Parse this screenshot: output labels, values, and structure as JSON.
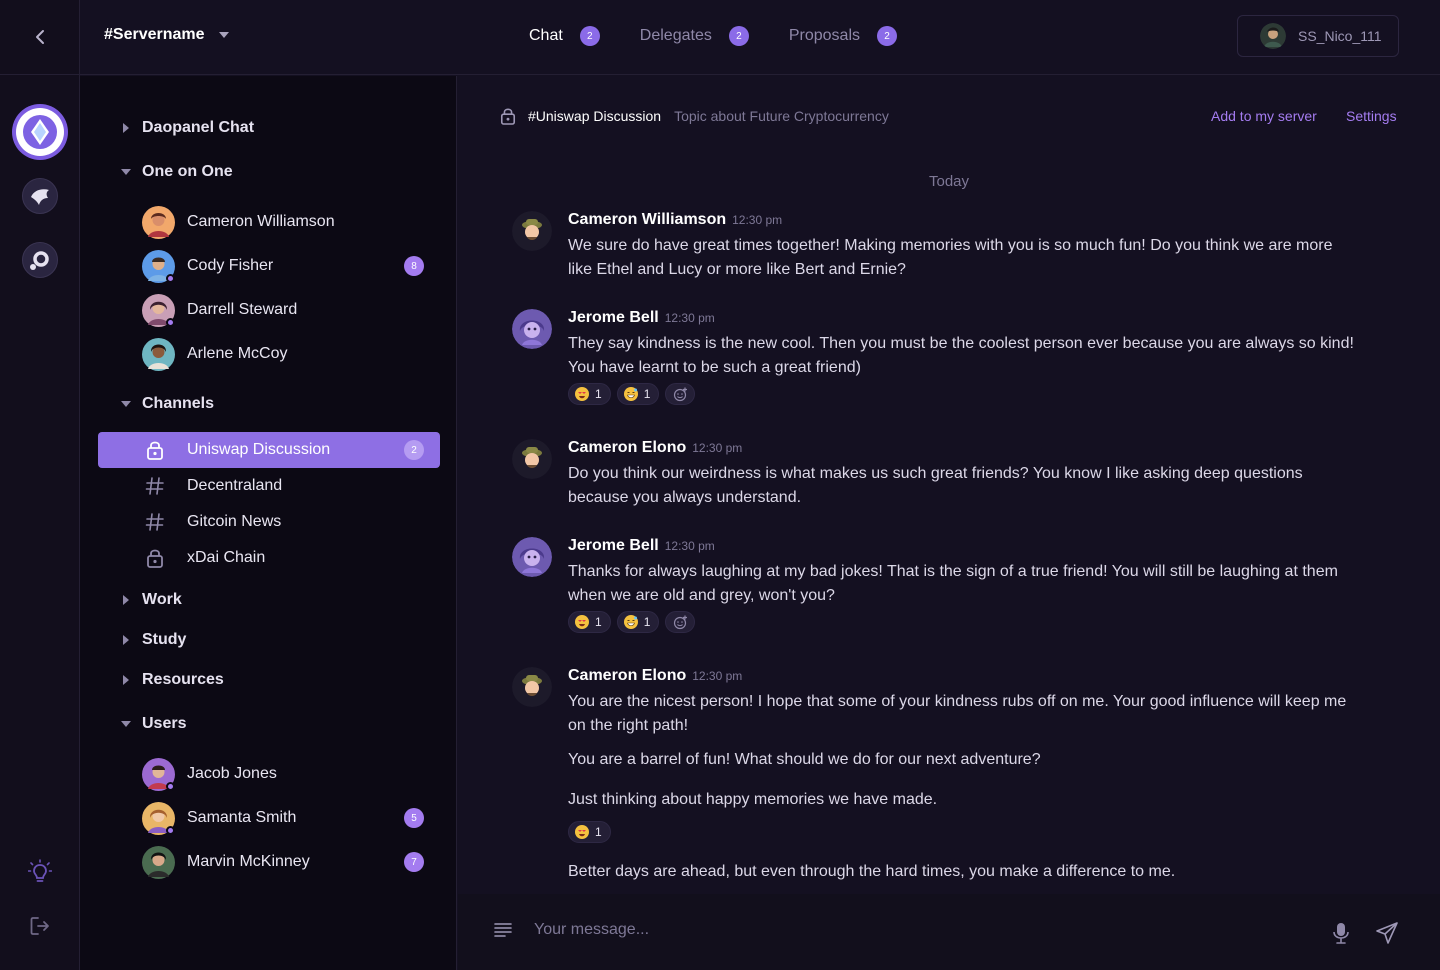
{
  "topbar": {
    "server_name": "#Servername",
    "tabs": [
      {
        "label": "Chat",
        "count": "2"
      },
      {
        "label": "Delegates",
        "count": "2"
      },
      {
        "label": "Proposals",
        "count": "2"
      }
    ],
    "username": "SS_Nico_111"
  },
  "sidebar": {
    "sections": {
      "daopanel": "Daopanel Chat",
      "one_on_one": "One on One",
      "channels": "Channels",
      "work": "Work",
      "study": "Study",
      "resources": "Resources",
      "users": "Users"
    },
    "dms": [
      {
        "name": "Cameron Williamson",
        "count": ""
      },
      {
        "name": "Cody Fisher",
        "count": "8"
      },
      {
        "name": "Darrell Steward",
        "count": ""
      },
      {
        "name": "Arlene McCoy",
        "count": ""
      }
    ],
    "channels": [
      {
        "name": "Uniswap Discussion",
        "icon": "lock-icon",
        "count": "2"
      },
      {
        "name": "Decentraland",
        "icon": "hash-icon",
        "count": ""
      },
      {
        "name": "Gitcoin News",
        "icon": "hash-icon",
        "count": ""
      },
      {
        "name": "xDai Chain",
        "icon": "lock-icon",
        "count": ""
      }
    ],
    "users": [
      {
        "name": "Jacob Jones",
        "count": ""
      },
      {
        "name": "Samanta Smith",
        "count": "5"
      },
      {
        "name": "Marvin McKinney",
        "count": "7"
      }
    ]
  },
  "chat": {
    "channel_title": "#Uniswap Discussion",
    "topic": "Topic about Future Cryptocurrency",
    "add_link": "Add to my server",
    "settings_link": "Settings",
    "day_label": "Today",
    "messages": [
      {
        "author": "Cameron Williamson",
        "time": "12:30 pm",
        "text": "We sure do have great times together! Making memories with you is so much fun! Do you think we are more like Ethel and Lucy or more like Bert and Ernie?"
      },
      {
        "author": "Jerome Bell",
        "time": "12:30 pm",
        "text": "They say kindness is the new cool. Then you must be the coolest person ever because you are always so kind! You have learnt to be such a great friend)",
        "reactions": [
          "1",
          "1"
        ]
      },
      {
        "author": "Cameron Elono",
        "time": "12:30 pm",
        "text": "Do you think our weirdness is what makes us such great friends? You know I like asking deep questions because you always understand."
      },
      {
        "author": "Jerome Bell",
        "time": "12:30 pm",
        "text": "Thanks for always laughing at my bad jokes! That is the sign of a true friend! You will still be laughing at them when we are old and grey, won't you?",
        "reactions": [
          "1",
          "1"
        ]
      },
      {
        "author": "Cameron Elono",
        "time": "12:30 pm",
        "text": "You are the nicest person! I hope that some of your kindness rubs off on me. Your good influence will keep me on the right path!",
        "followups": [
          "You are a barrel of fun! What should we do for our next adventure?",
          "Just thinking about happy memories we have made.",
          "Better days are ahead, but even through the hard times, you make a difference to me."
        ],
        "reaction": "1"
      }
    ],
    "composer_placeholder": "Your message..."
  },
  "colors": {
    "accent": "#8e6fe4",
    "background": "#141021",
    "sidebar": "#0c0914"
  }
}
